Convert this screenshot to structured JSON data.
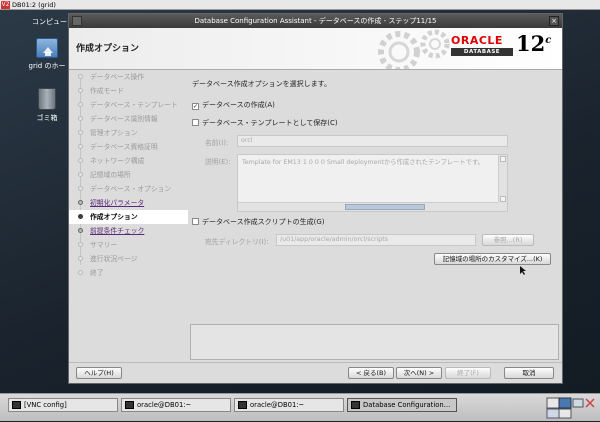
{
  "vnc": {
    "title": "DB01:2 (grid)",
    "logo": "V2"
  },
  "desktop": {
    "top_label": "コンピュー",
    "home_label": "grid のホー",
    "trash_label": "ゴミ箱"
  },
  "window": {
    "title": "Database Configuration Assistant - データベースの作成 - ステップ11/15",
    "close_glyph": "×",
    "step_title": "作成オプション",
    "oracle_word": "ORACLE",
    "database_word": "DATABASE",
    "version": "12",
    "version_suffix": "c"
  },
  "nav": {
    "items": [
      {
        "label": "データベース操作",
        "state": "done"
      },
      {
        "label": "作成モード",
        "state": "done"
      },
      {
        "label": "データベース・テンプレート",
        "state": "done"
      },
      {
        "label": "データベース識別情報",
        "state": "done"
      },
      {
        "label": "管理オプション",
        "state": "done"
      },
      {
        "label": "データベース資格証明",
        "state": "done"
      },
      {
        "label": "ネットワーク構成",
        "state": "done"
      },
      {
        "label": "記憶域の場所",
        "state": "done"
      },
      {
        "label": "データベース・オプション",
        "state": "done"
      },
      {
        "label": "初期化パラメータ",
        "state": "link"
      },
      {
        "label": "作成オプション",
        "state": "current"
      },
      {
        "label": "前提条件チェック",
        "state": "link"
      },
      {
        "label": "サマリー",
        "state": "todo"
      },
      {
        "label": "進行状況ページ",
        "state": "todo"
      },
      {
        "label": "終了",
        "state": "todo"
      }
    ]
  },
  "content": {
    "intro": "データベース作成オプションを選択します。",
    "create_db_label": "データベースの作成(A)",
    "create_db_checked": true,
    "save_template_label": "データベース・テンプレートとして保存(C)",
    "save_template_checked": false,
    "name_label": "名前(I):",
    "name_value": "orcl",
    "desc_label": "説明(E):",
    "desc_value": "Template for EM13 1 0 0 0 Small deploymentから作成されたテンプレートです。",
    "gen_scripts_label": "データベース作成スクリプトの生成(G)",
    "gen_scripts_checked": false,
    "dest_label": "宛先ディレクトリ(I):",
    "dest_value": "/u01/app/oracle/admin/orcl/scripts",
    "browse_label": "参照...(R)",
    "customize_storage_label": "記憶域の場所のカスタマイズ...(K)"
  },
  "footer": {
    "help_label": "ヘルプ(H)",
    "back_label": "< 戻る(B)",
    "next_label": "次へ(N) >",
    "finish_label": "終了(F)",
    "cancel_label": "取消"
  },
  "taskbar": {
    "tasks": [
      {
        "label": "[VNC config]",
        "active": false
      },
      {
        "label": "oracle@DB01:~",
        "active": false
      },
      {
        "label": "oracle@DB01:~",
        "active": false
      },
      {
        "label": "Database Configuration…",
        "active": true
      }
    ]
  },
  "colors": {
    "oracle_red": "#e00000",
    "link_purple": "#5a2a7a",
    "scroll_thumb": "#b8c8d8"
  }
}
